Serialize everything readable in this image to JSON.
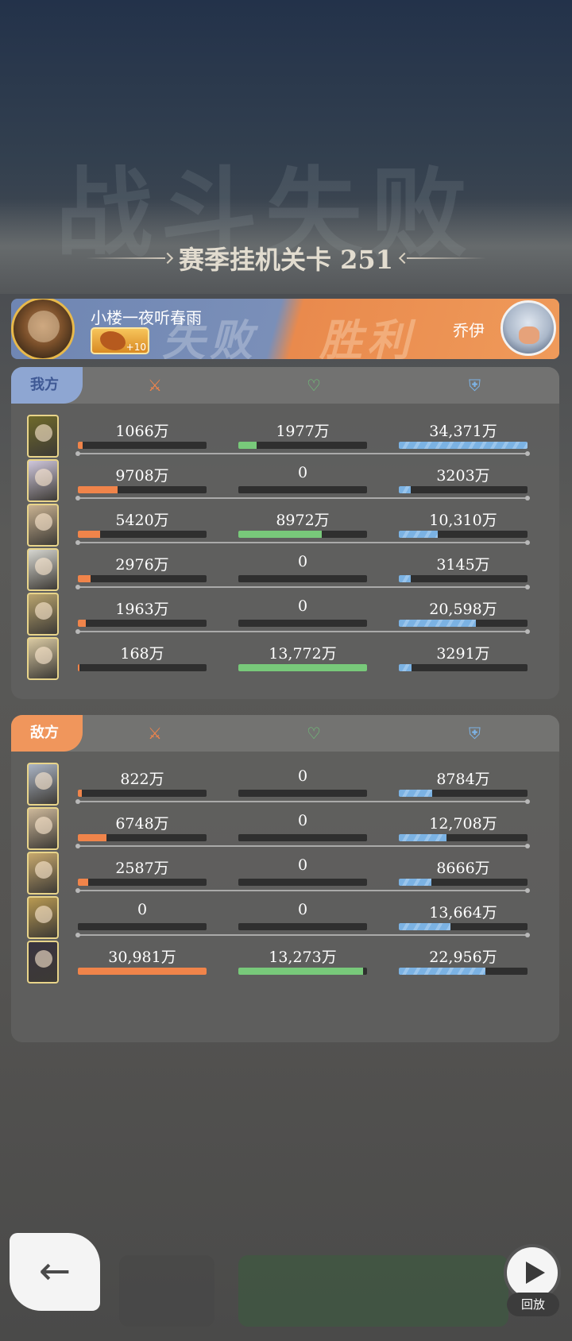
{
  "stage": {
    "title": "赛季挂机关卡 251",
    "background_text": "战斗失败"
  },
  "versus": {
    "lose_label": "失败",
    "win_label": "胜利",
    "player": {
      "name": "小楼一夜听春雨",
      "badge_level": "+10"
    },
    "enemy": {
      "name": "乔伊"
    }
  },
  "ours": {
    "tag": "我方",
    "heroes": [
      {
        "damage": "1066万",
        "damage_fill": 0.04,
        "heal": "1977万",
        "heal_fill": 0.14,
        "tank": "34,371万",
        "tank_fill": 1.0
      },
      {
        "damage": "9708万",
        "damage_fill": 0.31,
        "heal": "0",
        "heal_fill": 0,
        "tank": "3203万",
        "tank_fill": 0.09
      },
      {
        "damage": "5420万",
        "damage_fill": 0.17,
        "heal": "8972万",
        "heal_fill": 0.65,
        "tank": "10,310万",
        "tank_fill": 0.3
      },
      {
        "damage": "2976万",
        "damage_fill": 0.1,
        "heal": "0",
        "heal_fill": 0,
        "tank": "3145万",
        "tank_fill": 0.09
      },
      {
        "damage": "1963万",
        "damage_fill": 0.06,
        "heal": "0",
        "heal_fill": 0,
        "tank": "20,598万",
        "tank_fill": 0.6
      },
      {
        "damage": "168万",
        "damage_fill": 0.01,
        "heal": "13,772万",
        "heal_fill": 1.0,
        "tank": "3291万",
        "tank_fill": 0.1
      }
    ]
  },
  "theirs": {
    "tag": "敌方",
    "heroes": [
      {
        "damage": "822万",
        "damage_fill": 0.03,
        "heal": "0",
        "heal_fill": 0,
        "tank": "8784万",
        "tank_fill": 0.26
      },
      {
        "damage": "6748万",
        "damage_fill": 0.22,
        "heal": "0",
        "heal_fill": 0,
        "tank": "12,708万",
        "tank_fill": 0.37
      },
      {
        "damage": "2587万",
        "damage_fill": 0.08,
        "heal": "0",
        "heal_fill": 0,
        "tank": "8666万",
        "tank_fill": 0.25
      },
      {
        "damage": "0",
        "damage_fill": 0,
        "heal": "0",
        "heal_fill": 0,
        "tank": "13,664万",
        "tank_fill": 0.4
      },
      {
        "damage": "30,981万",
        "damage_fill": 1.0,
        "heal": "13,273万",
        "heal_fill": 0.97,
        "tank": "22,956万",
        "tank_fill": 0.67
      }
    ]
  },
  "hero_portrait_colors": {
    "ours": [
      "#6f6a2a",
      "#cfc7dc",
      "#c9b291",
      "#d6d6d0",
      "#b9a46e",
      "#d9c9a2"
    ],
    "theirs": [
      "#aab4c4",
      "#cdb89a",
      "#c7a86d",
      "#b99a52",
      "#3a3440"
    ]
  },
  "colors": {
    "damage": "#f0844a",
    "heal": "#78c97a",
    "tank": "#7bb2e3",
    "ours_accent": "#8ea6d2",
    "enemy_accent": "#f0965c"
  },
  "icons": {
    "damage": "sword-icon",
    "heal": "heart-icon",
    "tank": "shield-icon",
    "back": "arrow-left-icon",
    "replay": "replay-icon"
  },
  "controls": {
    "replay_label": "回放"
  }
}
